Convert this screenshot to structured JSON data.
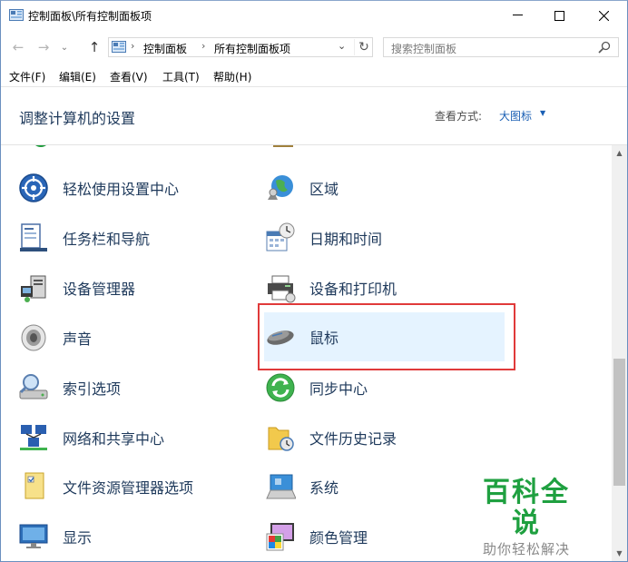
{
  "window": {
    "title": "控制面板\\所有控制面板项",
    "controls": {
      "minimize": "—",
      "maximize": "☐",
      "close": "✕"
    }
  },
  "nav": {
    "back_icon": "←",
    "forward_icon": "→",
    "recent_icon": "⌄",
    "up_icon": "↑",
    "breadcrumb": [
      "控制面板",
      "所有控制面板项"
    ],
    "breadcrumb_sep": "›",
    "dropdown_icon": "⌄",
    "refresh_icon": "↻",
    "search_placeholder": "搜索控制面板"
  },
  "menu": [
    "文件(F)",
    "编辑(E)",
    "查看(V)",
    "工具(T)",
    "帮助(H)"
  ],
  "header": {
    "title": "调整计算机的设置",
    "view_label": "查看方式:",
    "view_value": "大图标"
  },
  "items": {
    "left": [
      {
        "label": "轻松使用设置中心",
        "icon": "ease-of-access-icon"
      },
      {
        "label": "任务栏和导航",
        "icon": "taskbar-icon"
      },
      {
        "label": "设备管理器",
        "icon": "device-manager-icon"
      },
      {
        "label": "声音",
        "icon": "speaker-icon"
      },
      {
        "label": "索引选项",
        "icon": "indexing-icon"
      },
      {
        "label": "网络和共享中心",
        "icon": "network-icon"
      },
      {
        "label": "文件资源管理器选项",
        "icon": "folder-options-icon"
      },
      {
        "label": "显示",
        "icon": "display-icon"
      }
    ],
    "right": [
      {
        "label": "区域",
        "icon": "globe-icon"
      },
      {
        "label": "日期和时间",
        "icon": "calendar-clock-icon"
      },
      {
        "label": "设备和打印机",
        "icon": "printer-icon"
      },
      {
        "label": "鼠标",
        "icon": "mouse-icon",
        "selected": true
      },
      {
        "label": "同步中心",
        "icon": "sync-icon"
      },
      {
        "label": "文件历史记录",
        "icon": "file-history-icon"
      },
      {
        "label": "系统",
        "icon": "system-icon"
      },
      {
        "label": "颜色管理",
        "icon": "color-management-icon"
      }
    ]
  },
  "watermark": {
    "title": "百科全说",
    "subtitle": "助你轻松解决"
  },
  "colors": {
    "accent": "#1a5fb4",
    "selection": "#e5f3ff",
    "highlight_border": "#e03a3a",
    "watermark": "#1fa040"
  }
}
